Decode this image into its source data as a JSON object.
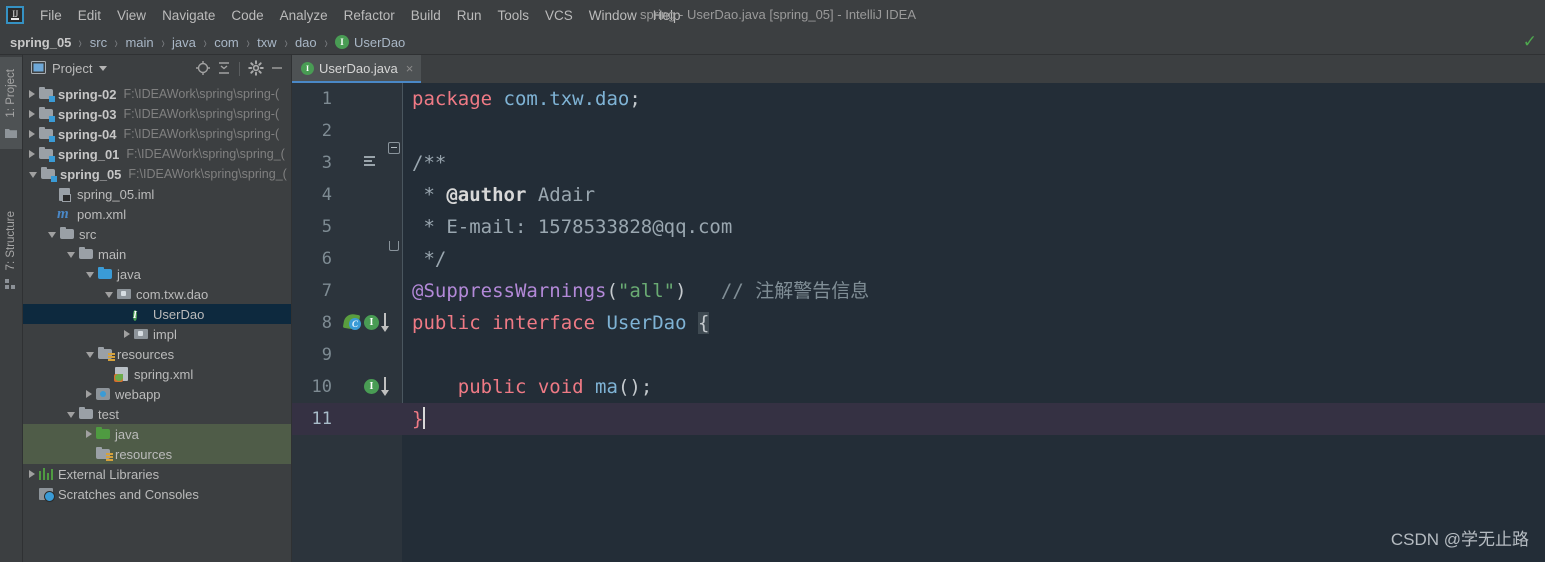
{
  "window": {
    "title": "spring - UserDao.java [spring_05] - IntelliJ IDEA",
    "logo_text": "IJ"
  },
  "menubar": {
    "items": [
      {
        "label": "File"
      },
      {
        "label": "Edit"
      },
      {
        "label": "View"
      },
      {
        "label": "Navigate"
      },
      {
        "label": "Code"
      },
      {
        "label": "Analyze"
      },
      {
        "label": "Refactor"
      },
      {
        "label": "Build"
      },
      {
        "label": "Run"
      },
      {
        "label": "Tools"
      },
      {
        "label": "VCS"
      },
      {
        "label": "Window"
      },
      {
        "label": "Help"
      }
    ]
  },
  "breadcrumb": {
    "items": [
      "spring_05",
      "src",
      "main",
      "java",
      "com",
      "txw",
      "dao",
      "UserDao"
    ],
    "separator": "›",
    "last_badge": "I"
  },
  "toolstrip": {
    "project_tab": "1: Project",
    "structure_tab": "7: Structure"
  },
  "project_panel": {
    "title": "Project",
    "toolbar": [
      "locate-icon",
      "collapse-all-icon",
      "settings-icon",
      "hide-icon"
    ],
    "tree": [
      {
        "indent": 0,
        "arrow": "closed",
        "icon": "module-folder",
        "label": "spring-02",
        "bold": true,
        "path": "F:\\IDEAWork\\spring\\spring-(",
        "select": ""
      },
      {
        "indent": 0,
        "arrow": "closed",
        "icon": "module-folder",
        "label": "spring-03",
        "bold": true,
        "path": "F:\\IDEAWork\\spring\\spring-(",
        "select": ""
      },
      {
        "indent": 0,
        "arrow": "closed",
        "icon": "module-folder",
        "label": "spring-04",
        "bold": true,
        "path": "F:\\IDEAWork\\spring\\spring-(",
        "select": ""
      },
      {
        "indent": 0,
        "arrow": "closed",
        "icon": "module-folder",
        "label": "spring_01",
        "bold": true,
        "path": "F:\\IDEAWork\\spring\\spring_(",
        "select": ""
      },
      {
        "indent": 0,
        "arrow": "open",
        "icon": "module-folder",
        "label": "spring_05",
        "bold": true,
        "path": "F:\\IDEAWork\\spring\\spring_(",
        "select": ""
      },
      {
        "indent": 1,
        "arrow": "none",
        "icon": "iml-file",
        "label": "spring_05.iml",
        "bold": false,
        "path": "",
        "select": ""
      },
      {
        "indent": 1,
        "arrow": "none",
        "icon": "maven-m",
        "label": "pom.xml",
        "bold": false,
        "path": "",
        "select": ""
      },
      {
        "indent": 1,
        "arrow": "open",
        "icon": "folder",
        "label": "src",
        "bold": false,
        "path": "",
        "select": ""
      },
      {
        "indent": 2,
        "arrow": "open",
        "icon": "folder",
        "label": "main",
        "bold": false,
        "path": "",
        "select": ""
      },
      {
        "indent": 3,
        "arrow": "open",
        "icon": "source-folder",
        "label": "java",
        "bold": false,
        "path": "",
        "select": ""
      },
      {
        "indent": 4,
        "arrow": "open",
        "icon": "package",
        "label": "com.txw.dao",
        "bold": false,
        "path": "",
        "select": ""
      },
      {
        "indent": 5,
        "arrow": "none",
        "icon": "interface",
        "label": "UserDao",
        "bold": false,
        "path": "",
        "select": "blue"
      },
      {
        "indent": 5,
        "arrow": "closed",
        "icon": "package",
        "label": "impl",
        "bold": false,
        "path": "",
        "select": ""
      },
      {
        "indent": 3,
        "arrow": "open",
        "icon": "resources-folder",
        "label": "resources",
        "bold": false,
        "path": "",
        "select": ""
      },
      {
        "indent": 4,
        "arrow": "none",
        "icon": "spring-xml",
        "label": "spring.xml",
        "bold": false,
        "path": "",
        "select": ""
      },
      {
        "indent": 3,
        "arrow": "closed",
        "icon": "webapp",
        "label": "webapp",
        "bold": false,
        "path": "",
        "select": ""
      },
      {
        "indent": 2,
        "arrow": "open",
        "icon": "folder",
        "label": "test",
        "bold": false,
        "path": "",
        "select": ""
      },
      {
        "indent": 3,
        "arrow": "closed",
        "icon": "test-source-folder",
        "label": "java",
        "bold": false,
        "path": "",
        "select": "green"
      },
      {
        "indent": 3,
        "arrow": "none",
        "icon": "test-resources-folder",
        "label": "resources",
        "bold": false,
        "path": "",
        "select": "green"
      },
      {
        "indent": 0,
        "arrow": "closed",
        "icon": "libraries",
        "label": "External Libraries",
        "bold": false,
        "path": "",
        "select": ""
      },
      {
        "indent": 0,
        "arrow": "none",
        "icon": "scratches",
        "label": "Scratches and Consoles",
        "bold": false,
        "path": "",
        "select": ""
      }
    ]
  },
  "editor": {
    "tab": {
      "label": "UserDao.java",
      "badge": "I",
      "close": "×"
    },
    "lines": [
      {
        "num": "1",
        "current": false
      },
      {
        "num": "2",
        "current": false
      },
      {
        "num": "3",
        "current": false
      },
      {
        "num": "4",
        "current": false
      },
      {
        "num": "5",
        "current": false
      },
      {
        "num": "6",
        "current": false
      },
      {
        "num": "7",
        "current": false
      },
      {
        "num": "8",
        "current": false
      },
      {
        "num": "9",
        "current": false
      },
      {
        "num": "10",
        "current": false
      },
      {
        "num": "11",
        "current": true
      }
    ],
    "code": {
      "l1_kw": "package",
      "l1_pkg": " com.txw.dao",
      "l1_semi": ";",
      "l3": "/**",
      "l4_star": " * ",
      "l4_tag": "@author",
      "l4_val": " Adair",
      "l5": " * E-mail: 1578533828@qq.com",
      "l6": " */",
      "l7_ann": "@SuppressWarnings",
      "l7_paren_open": "(",
      "l7_str": "\"all\"",
      "l7_paren_close": ")",
      "l7_comment": "// 注解警告信息",
      "l8_public": "public",
      "l8_interface": " interface",
      "l8_name": " UserDao",
      "l8_brace": "{",
      "l10_public": "public",
      "l10_void": " void",
      "l10_name": " ma",
      "l10_rest": "();",
      "l11_brace": "}"
    },
    "gutter_icons": {
      "line8_bean": "spring-bean-icon",
      "line8_impl": "I",
      "line10_impl": "I"
    }
  },
  "watermark": "CSDN @学无止路",
  "colors": {
    "accent": "#4a88c7",
    "editor_bg": "#232d37",
    "gutter_bg": "#2c343c",
    "panel_bg": "#3c3f41",
    "keyword": "#ef7a85",
    "identifier": "#7fb3d5",
    "annotation": "#b389d8",
    "string": "#6aab73",
    "comment": "#808e96",
    "selection_blue": "#0d293e",
    "selection_green": "#4f5c48",
    "current_line": "#353143"
  }
}
